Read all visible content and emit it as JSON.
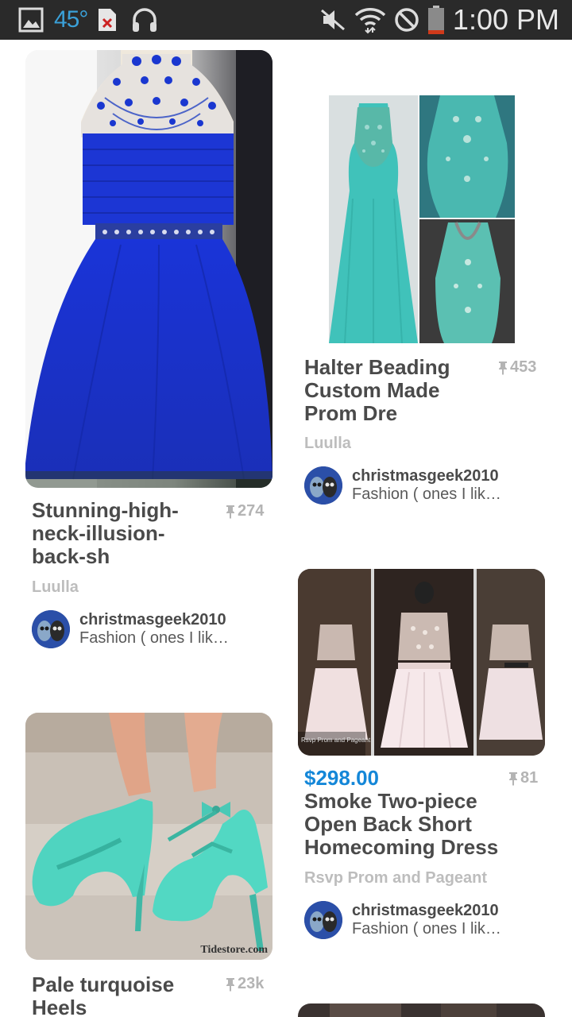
{
  "status_bar": {
    "temperature": "45°",
    "time": "1:00 PM",
    "icons": [
      "gallery-icon",
      "file-error-icon",
      "headphones-icon",
      "mute-icon",
      "wifi-icon",
      "blocked-icon",
      "battery-icon"
    ]
  },
  "pins": [
    {
      "title": "Stunning-high-\nneck-illusion-\nback-sh",
      "repin_count": "274",
      "source": "Luulla",
      "pinner_name": "christmasgeek2010",
      "board": "Fashion ( ones I lik…",
      "image": "royal-blue-dress-photo"
    },
    {
      "title": "Halter Beading\nCustom Made\nProm Dre",
      "repin_count": "453",
      "source": "Luulla",
      "pinner_name": "christmasgeek2010",
      "board": "Fashion ( ones I lik…",
      "image": "turquoise-gown-photo"
    },
    {
      "price": "$298.00",
      "title": "Smoke Two-piece\nOpen Back Short\nHomecoming Dress",
      "repin_count": "81",
      "source": "Rsvp Prom and Pageant",
      "pinner_name": "christmasgeek2010",
      "board": "Fashion ( ones I lik…",
      "image": "two-piece-dress-photo"
    },
    {
      "title": "Pale turquoise\nHeels",
      "repin_count": "23k",
      "watermark": "Tidestore.com",
      "image": "turquoise-heels-photo"
    }
  ],
  "colors": {
    "status_bar_bg": "#2a2a2a",
    "price": "#1487d8",
    "title": "#4a4a4a",
    "meta": "#b4b4b4"
  }
}
